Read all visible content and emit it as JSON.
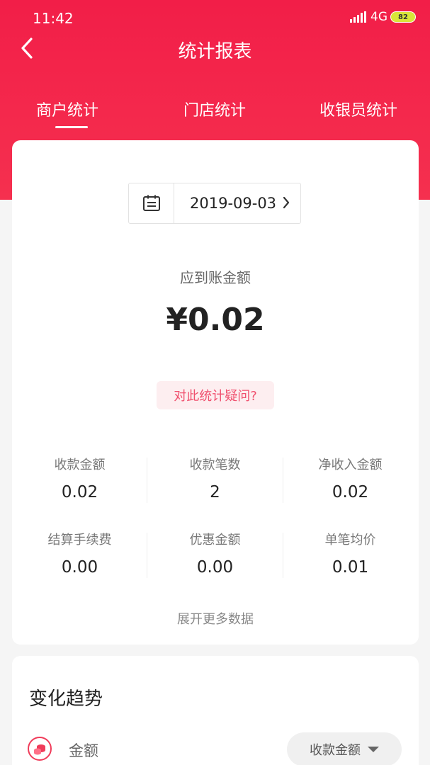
{
  "status_bar": {
    "time": "11:42",
    "network": "4G",
    "battery": "82"
  },
  "nav": {
    "title": "统计报表"
  },
  "tabs": [
    {
      "label": "商户统计",
      "active": true
    },
    {
      "label": "门店统计",
      "active": false
    },
    {
      "label": "收银员统计",
      "active": false
    }
  ],
  "summary": {
    "date": "2019-09-03",
    "amount_label": "应到账金额",
    "amount_value": "¥0.02",
    "question_label": "对此统计疑问?"
  },
  "stats": [
    {
      "label": "收款金额",
      "value": "0.02"
    },
    {
      "label": "收款笔数",
      "value": "2"
    },
    {
      "label": "净收入金额",
      "value": "0.02"
    },
    {
      "label": "结算手续费",
      "value": "0.00"
    },
    {
      "label": "优惠金额",
      "value": "0.00"
    },
    {
      "label": "单笔均价",
      "value": "0.01"
    }
  ],
  "more_data_label": "展开更多数据",
  "trend": {
    "title": "变化趋势",
    "legend_label": "金额",
    "dropdown_value": "收款金额"
  },
  "colors": {
    "brand": "#f21e48",
    "accent_text": "#f0506e"
  }
}
